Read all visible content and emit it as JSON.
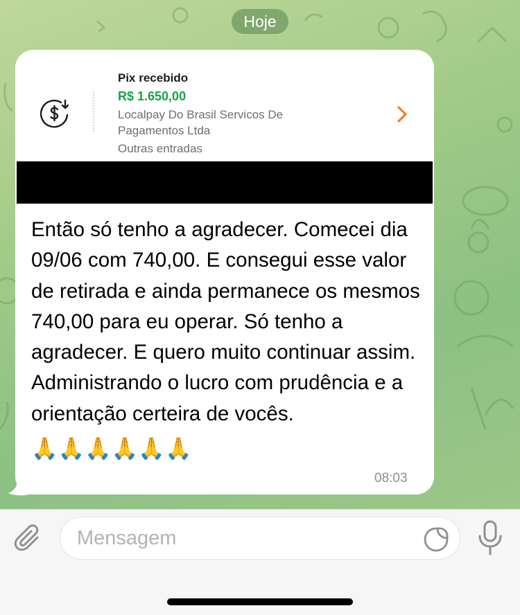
{
  "date_separator": "Hoje",
  "pix_card": {
    "title": "Pix recebido",
    "amount": "R$ 1.650,00",
    "payer": "Localpay Do Brasil Servicos De Pagamentos Ltda",
    "category": "Outras entradas",
    "icon": "money-received-icon",
    "chevron_icon": "chevron-right-icon"
  },
  "message": {
    "text": "Então só tenho a agradecer. Comecei dia 09/06 com 740,00. E consegui esse valor de retirada e ainda permanece os mesmos 740,00 para eu operar. Só tenho a agradecer. E quero muito continuar assim. Administrando o lucro com prudência e a orientação certeira de vocês.",
    "emoji": "🙏🙏🙏🙏🙏🙏",
    "time": "08:03"
  },
  "composer": {
    "placeholder": "Mensagem",
    "attach_icon": "paperclip-icon",
    "sticker_icon": "sticker-icon",
    "mic_icon": "microphone-icon"
  },
  "colors": {
    "amount_green": "#1aa048",
    "chevron_orange": "#e8832a",
    "wallpaper_green": "#9fca86"
  }
}
